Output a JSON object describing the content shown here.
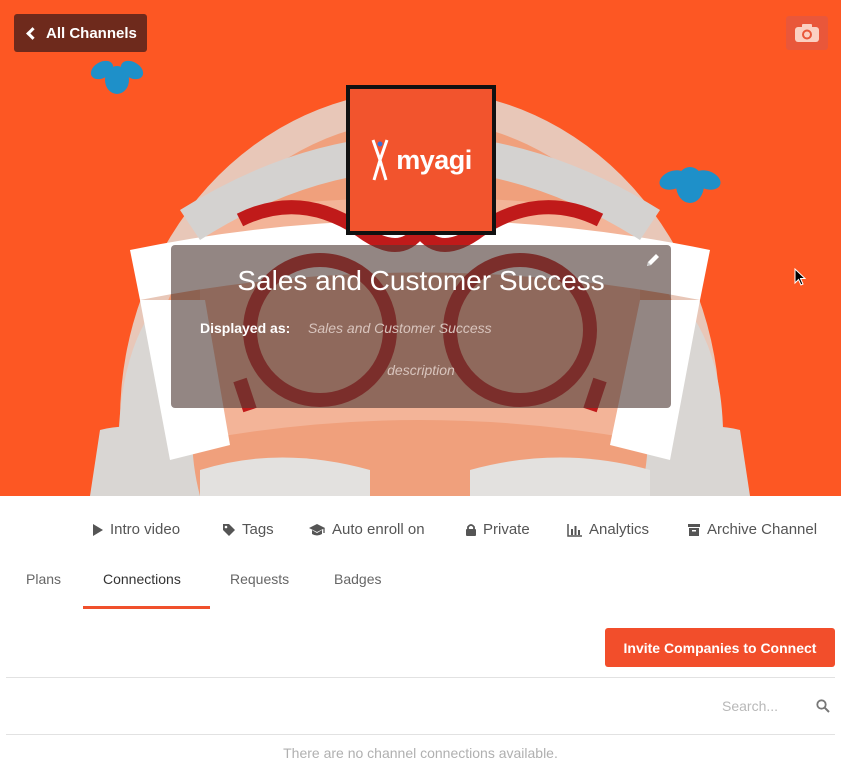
{
  "header": {
    "back_label": "All Channels",
    "camera_icon": "camera-icon",
    "logo_text": "myagi"
  },
  "channel": {
    "title": "Sales and Customer Success",
    "displayed_as_label": "Displayed as:",
    "displayed_as_value": "Sales and Customer Success",
    "description": "description"
  },
  "actions": [
    {
      "label": "Intro video",
      "icon": "play-icon"
    },
    {
      "label": "Tags",
      "icon": "tag-icon"
    },
    {
      "label": "Auto enroll on",
      "icon": "graduation-cap-icon"
    },
    {
      "label": "Private",
      "icon": "lock-icon"
    },
    {
      "label": "Analytics",
      "icon": "bar-chart-icon"
    },
    {
      "label": "Archive Channel",
      "icon": "archive-icon"
    }
  ],
  "tabs": [
    {
      "label": "Plans",
      "active": false
    },
    {
      "label": "Connections",
      "active": true
    },
    {
      "label": "Requests",
      "active": false
    },
    {
      "label": "Badges",
      "active": false
    }
  ],
  "invite_button": "Invite Companies to Connect",
  "search": {
    "placeholder": "Search..."
  },
  "empty_message": "There are no channel connections available.",
  "colors": {
    "banner": "#fd5723",
    "accent": "#f24e2b",
    "back_button": "#6e2a1c"
  }
}
